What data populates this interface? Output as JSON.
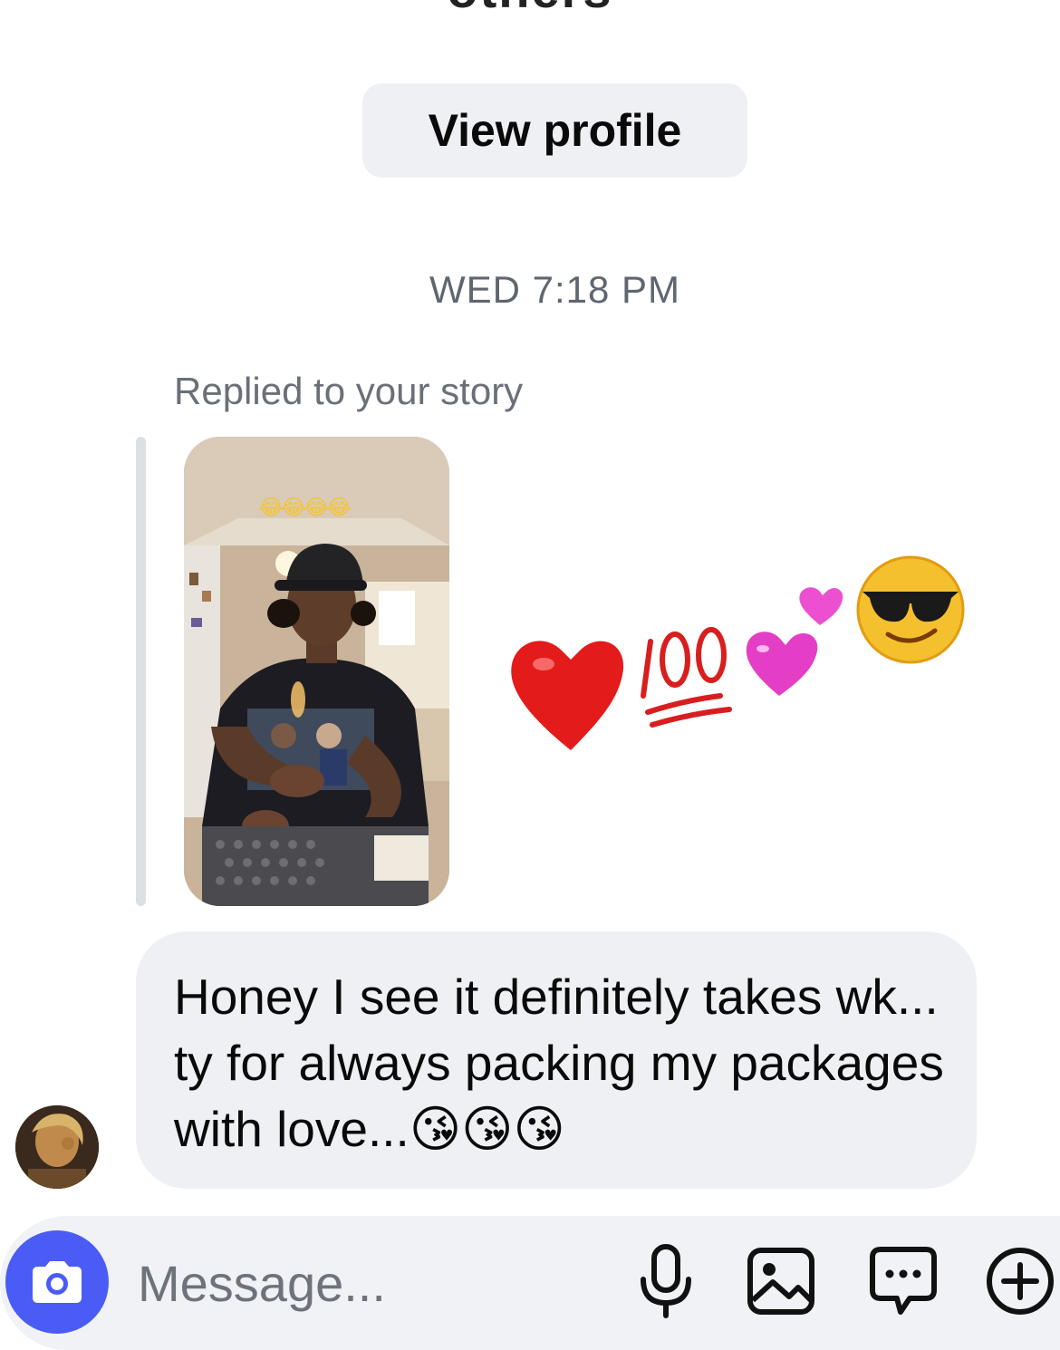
{
  "header": {
    "cut_off_text": "others",
    "view_profile_label": "View profile"
  },
  "thread": {
    "timestamp": "WED 7:18 PM",
    "story_reply_label": "Replied to your story",
    "story_overlay_emoji": "😂😂😂😂",
    "reaction_emojis": [
      "heart",
      "hundred-points",
      "two-hearts",
      "sunglasses-face"
    ],
    "message_text": "Honey I see it definitely takes wk... ty for always packing my packages with love...😘😘😘"
  },
  "composer": {
    "placeholder": "Message...",
    "icons": [
      "camera-icon",
      "microphone-icon",
      "image-icon",
      "sticker-chat-icon",
      "plus-icon"
    ]
  },
  "colors": {
    "accent": "#4a5cf5",
    "bubble_bg": "#eff0f3",
    "timestamp_text": "#5f6670"
  }
}
